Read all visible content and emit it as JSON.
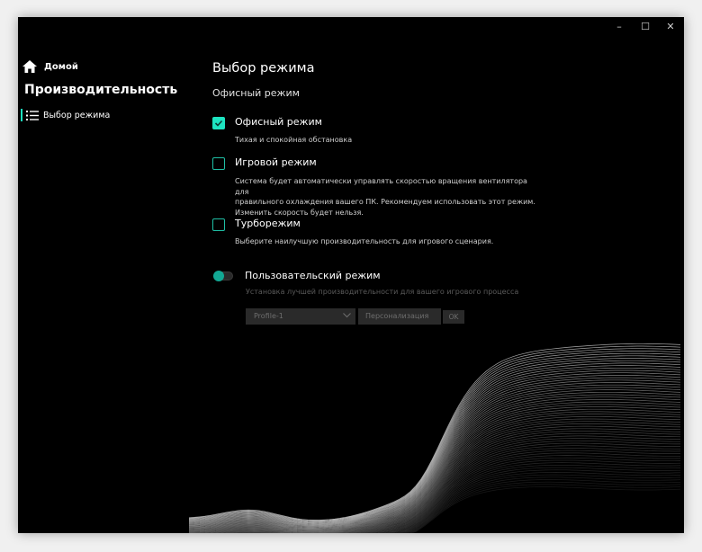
{
  "window": {
    "minimize": "–",
    "maximize": "☐",
    "close": "✕"
  },
  "sidebar": {
    "home_label": "Домой",
    "section_title": "Производительность",
    "items": [
      {
        "label": "Выбор режима",
        "icon": "list-icon",
        "active": true
      }
    ]
  },
  "main": {
    "page_title": "Выбор режима",
    "current_mode": "Офисный режим",
    "options": [
      {
        "label": "Офисный режим",
        "checked": true,
        "description": [
          "Тихая и спокойная обстановка"
        ]
      },
      {
        "label": "Игровой режим",
        "checked": false,
        "description": [
          "Система будет автоматически управлять скоростью вращения вентилятора для",
          "правильного охлаждения вашего ПК. Рекомендуем использовать этот режим.",
          "Изменить скорость будет нельзя."
        ]
      },
      {
        "label": "Турборежим",
        "checked": false,
        "description": [
          "Выберите наилучшую производительность для игрового сценария."
        ]
      }
    ],
    "custom": {
      "label": "Пользовательский режим",
      "enabled": false,
      "description": "Установка лучшей производительности для вашего игрового процесса",
      "profile_value": "Profile-1",
      "personalize_label": "Персонализация",
      "ok_label": "OK"
    }
  },
  "colors": {
    "accent": "#1de3c0",
    "background": "#000000",
    "disabled_text": "#5a5a5a"
  }
}
